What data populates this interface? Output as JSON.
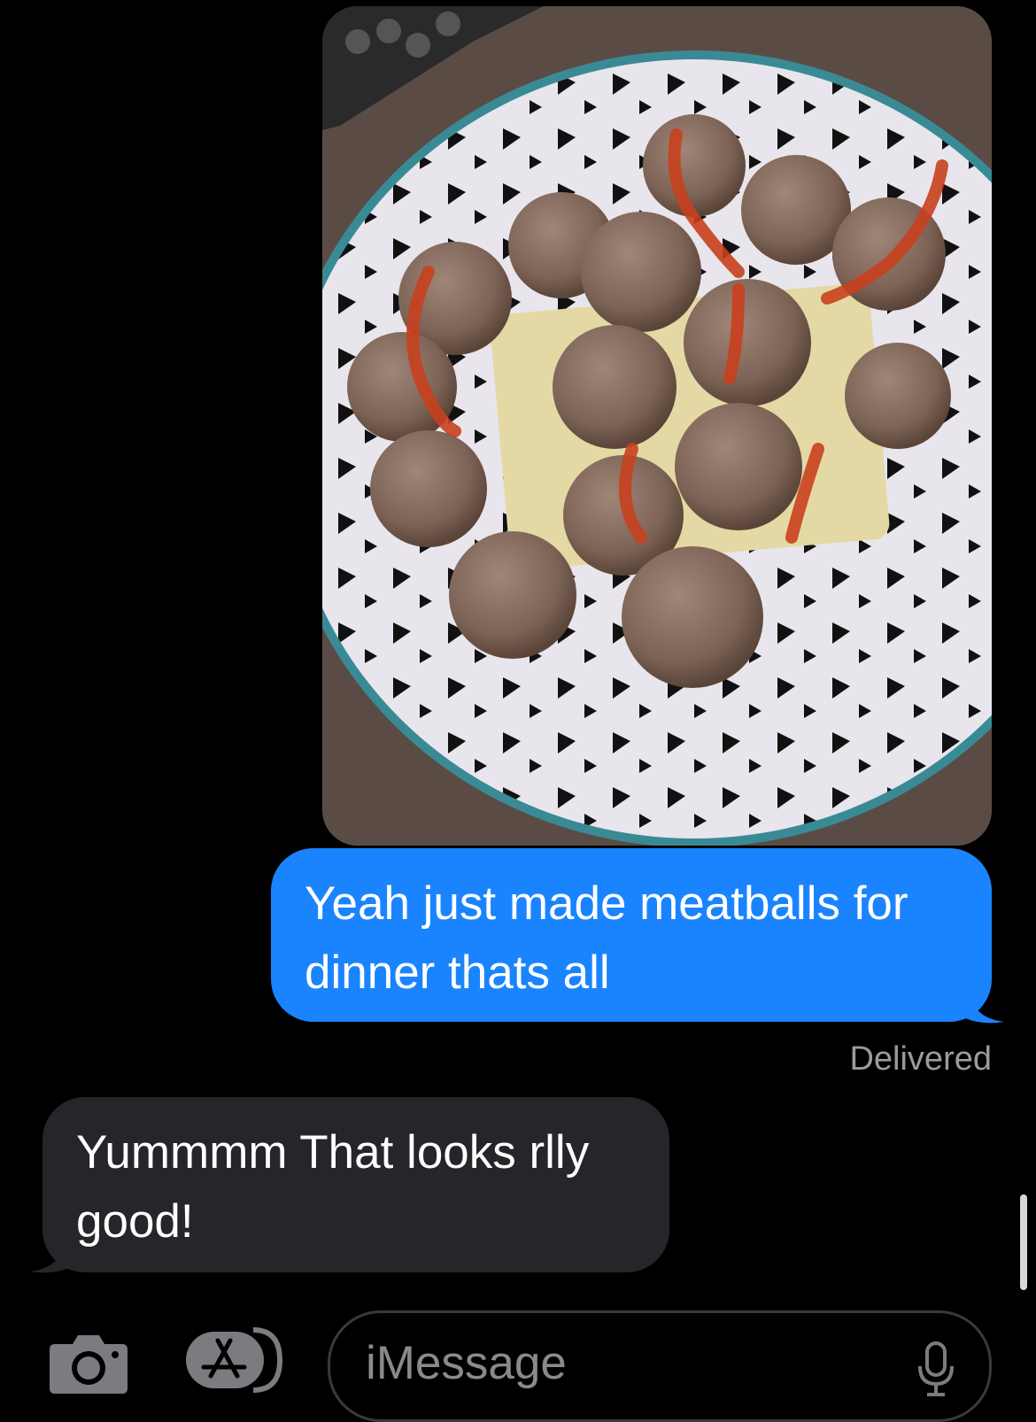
{
  "conversation": {
    "photo": {
      "icon": "photo-attachment",
      "description_icon": "meatballs-plate-image"
    },
    "outgoing_message": "Yeah just made meatballs for dinner thats all",
    "outgoing_status": "Delivered",
    "incoming_message": "Yummmm That looks rlly good!"
  },
  "composer": {
    "camera_icon": "camera-icon",
    "appstore_icon": "app-store-icon",
    "input_placeholder": "iMessage",
    "mic_icon": "microphone-icon"
  },
  "colors": {
    "background": "#000000",
    "outgoing_bubble": "#1a84ff",
    "incoming_bubble": "#26252a",
    "status_text": "#9a9aa0",
    "placeholder": "#8a8a8e"
  }
}
